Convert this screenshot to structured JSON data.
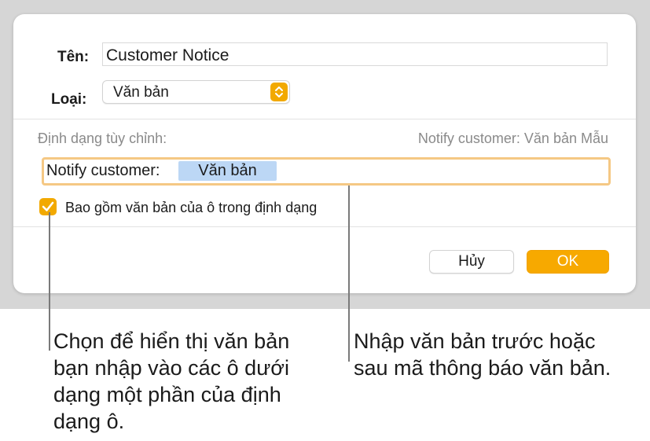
{
  "dialog": {
    "name_label": "Tên:",
    "name_value": "Customer Notice",
    "type_label": "Loại:",
    "type_value": "Văn bản",
    "custom_format_label": "Định dạng tùy chỉnh:",
    "preview": "Notify customer: Văn bản Mẫu",
    "format_prefix": "Notify customer:",
    "format_token": "Văn bản",
    "include_checkbox_label": "Bao gồm văn bản của ô trong định dạng",
    "include_checked": true,
    "cancel_label": "Hủy",
    "ok_label": "OK"
  },
  "callouts": {
    "left": "Chọn để hiển thị văn bản bạn nhập vào các ô dưới dạng một phần của định dạng ô.",
    "right": "Nhập văn bản trước hoặc sau mã thông báo văn bản."
  },
  "colors": {
    "accent": "#f2a900",
    "token_bg": "#bcd7f5",
    "focus_ring": "#f5c884"
  }
}
